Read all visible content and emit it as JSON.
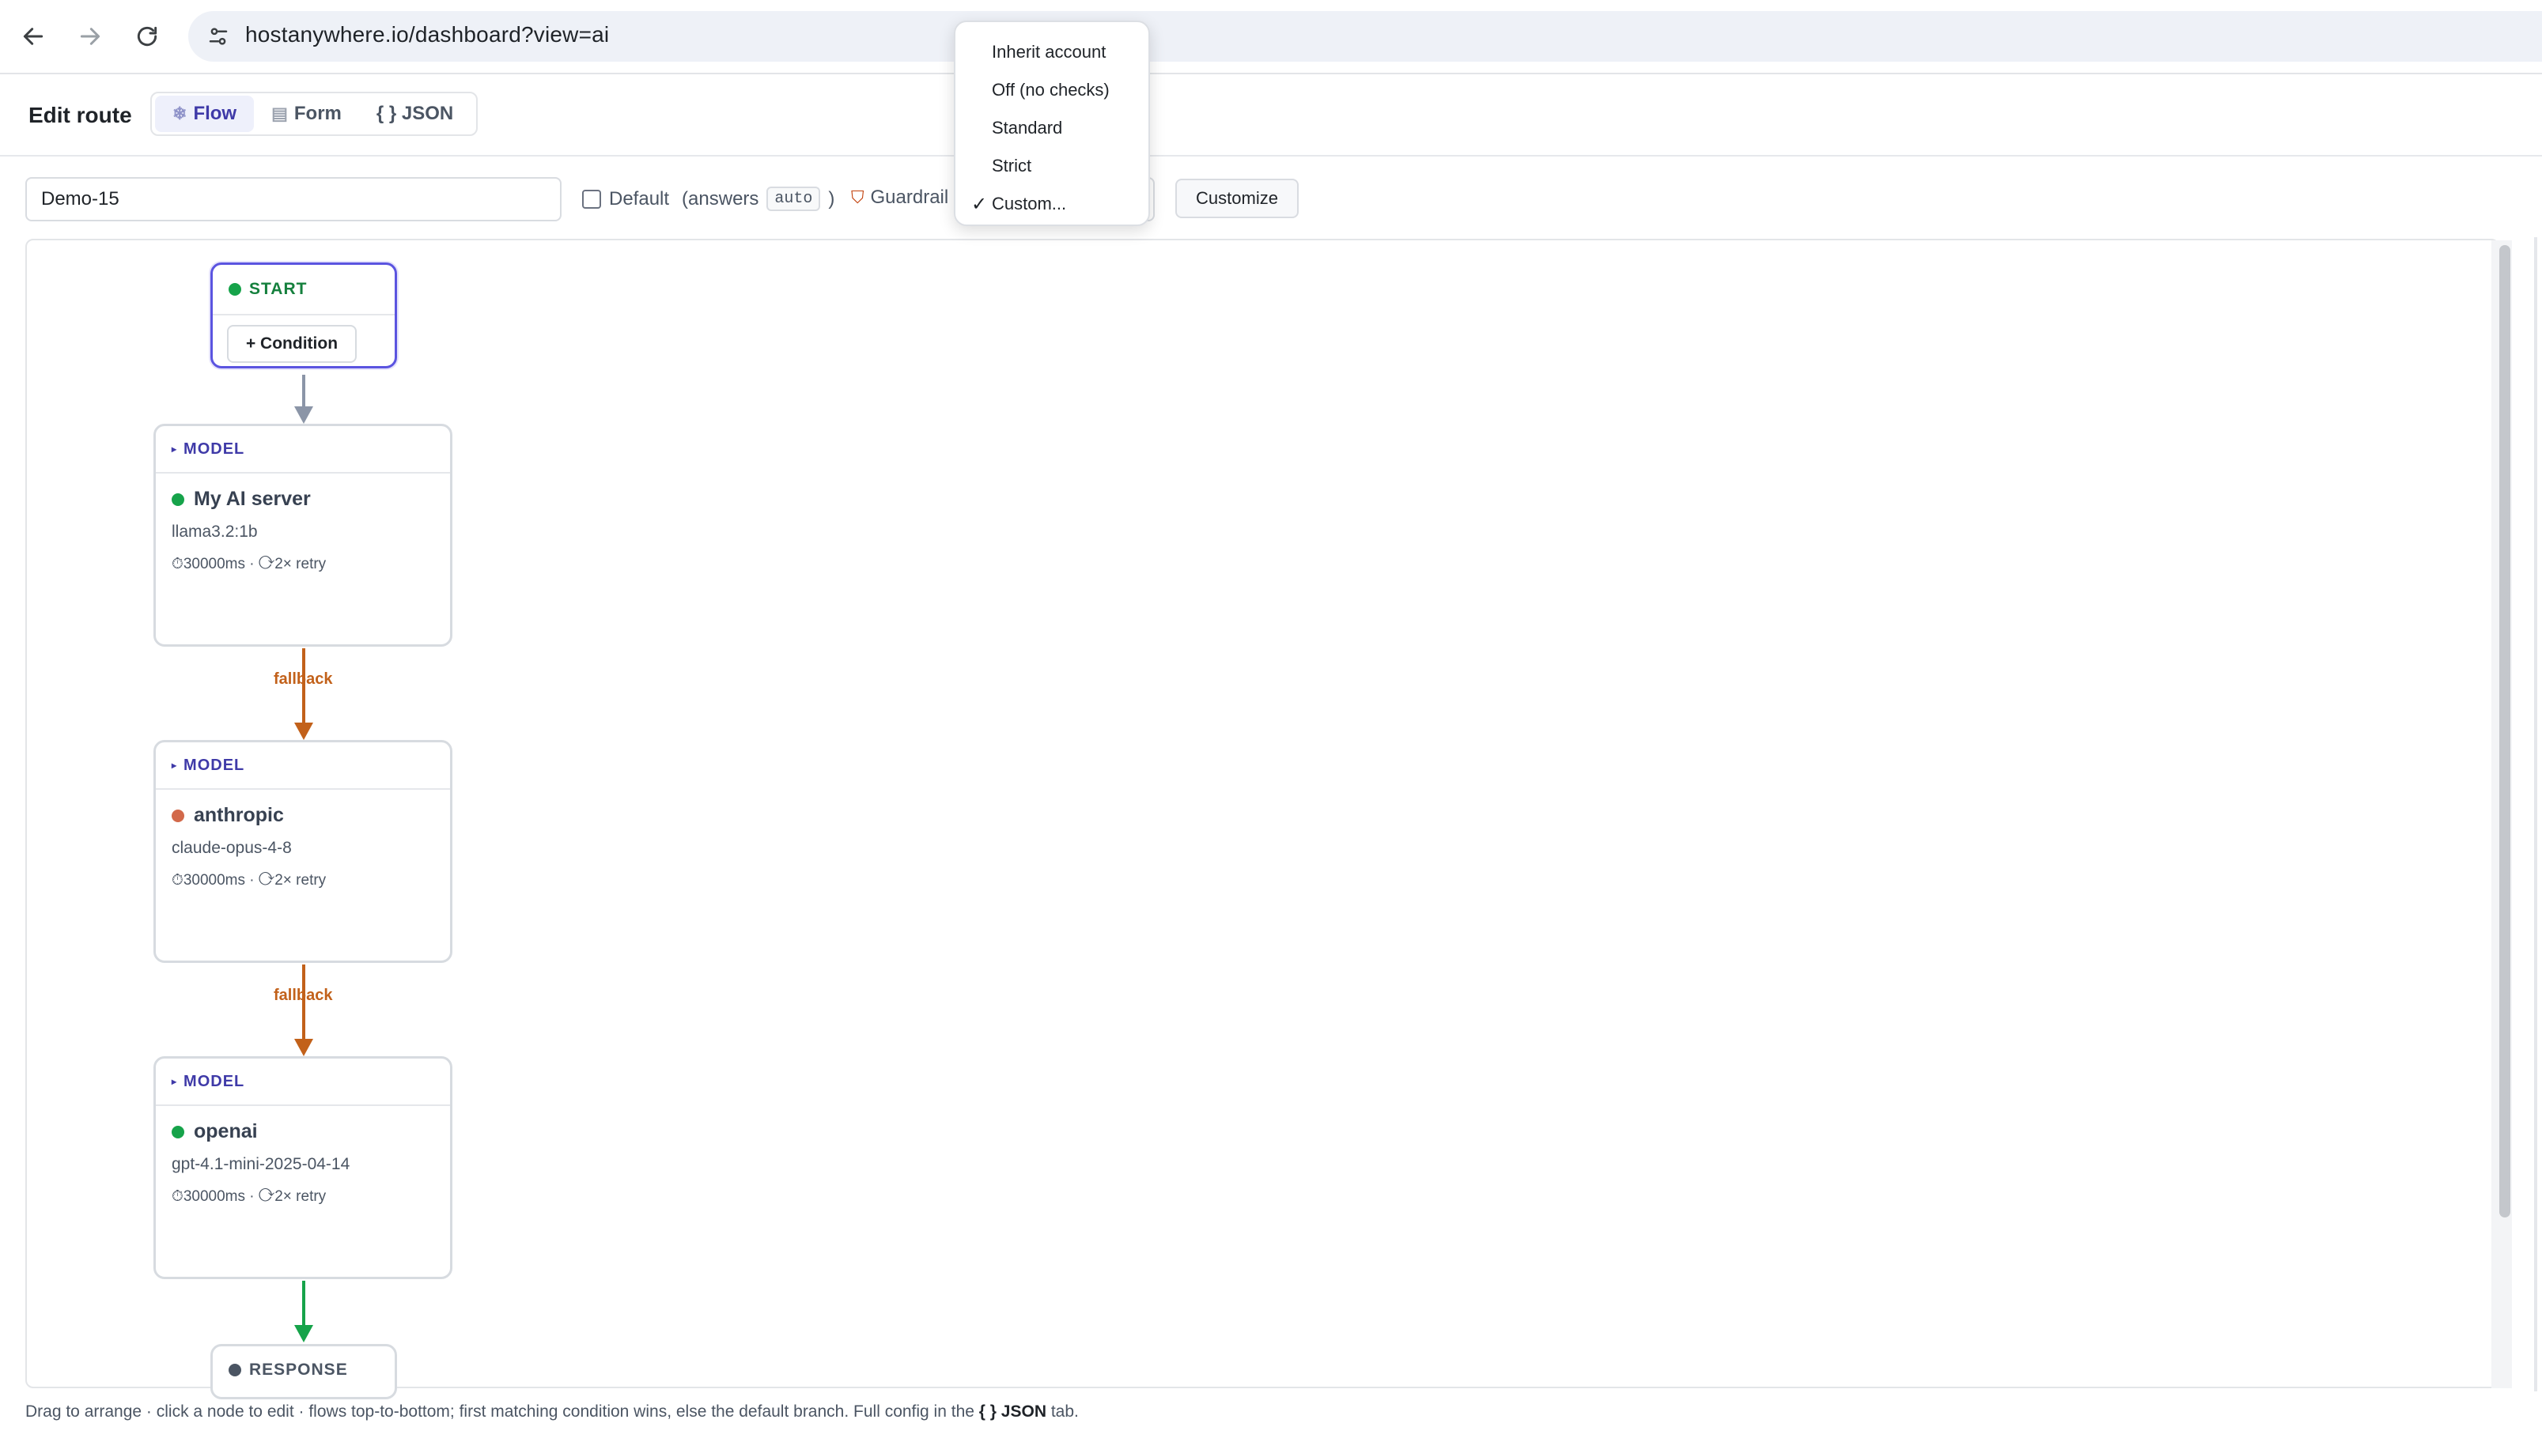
{
  "browser": {
    "url": "hostanywhere.io/dashboard?view=ai",
    "back_icon": "arrow-left-icon",
    "forward_icon": "arrow-right-icon",
    "reload_icon": "reload-icon",
    "site_info_icon": "tune-icon"
  },
  "header": {
    "title": "Edit route",
    "tabs": [
      {
        "label": "Flow",
        "icon": "snowflake-icon",
        "active": true
      },
      {
        "label": "Form",
        "icon": "square-icon",
        "active": false
      },
      {
        "label": "{ } JSON",
        "icon": "",
        "active": false
      }
    ]
  },
  "toolbar": {
    "route_name": "Demo-15",
    "default_label": "Default",
    "answers_prefix": "(answers",
    "answers_value": "auto",
    "answers_suffix": ")",
    "default_checked": false,
    "guardrail_label": "Guardrail",
    "customize_label": "Customize"
  },
  "guardrail_menu": {
    "options": [
      "Inherit account",
      "Off (no checks)",
      "Standard",
      "Strict",
      "Custom..."
    ],
    "selected": "Custom..."
  },
  "flow": {
    "start": {
      "label": "START",
      "condition_button": "+ Condition",
      "color": "#16a34a"
    },
    "models": [
      {
        "type_label": "MODEL",
        "name": "My AI server",
        "model": "llama3.2:1b",
        "meta": "⏱30000ms · ⟳2× retry",
        "status_color": "#16a34a"
      },
      {
        "type_label": "MODEL",
        "name": "anthropic",
        "model": "claude-opus-4-8",
        "meta": "⏱30000ms · ⟳2× retry",
        "status_color": "#d2694a"
      },
      {
        "type_label": "MODEL",
        "name": "openai",
        "model": "gpt-4.1-mini-2025-04-14",
        "meta": "⏱30000ms · ⟳2× retry",
        "status_color": "#16a34a"
      }
    ],
    "edges": [
      {
        "from": "start",
        "to": "model-1",
        "label": "",
        "color": "#8b95a7"
      },
      {
        "from": "model-1",
        "to": "model-2",
        "label": "fallback",
        "color": "#c2611a"
      },
      {
        "from": "model-2",
        "to": "model-3",
        "label": "fallback",
        "color": "#c2611a"
      },
      {
        "from": "model-3",
        "to": "response",
        "label": "",
        "color": "#16a34a"
      }
    ],
    "response": {
      "label": "RESPONSE",
      "color": "#4b5563"
    }
  },
  "footer": {
    "note_prefix": "Drag to arrange · click a node to edit · flows top-to-bottom; first matching condition wins, else the default branch. Full config in the",
    "note_bold": "{ } JSON",
    "note_suffix": "tab."
  }
}
